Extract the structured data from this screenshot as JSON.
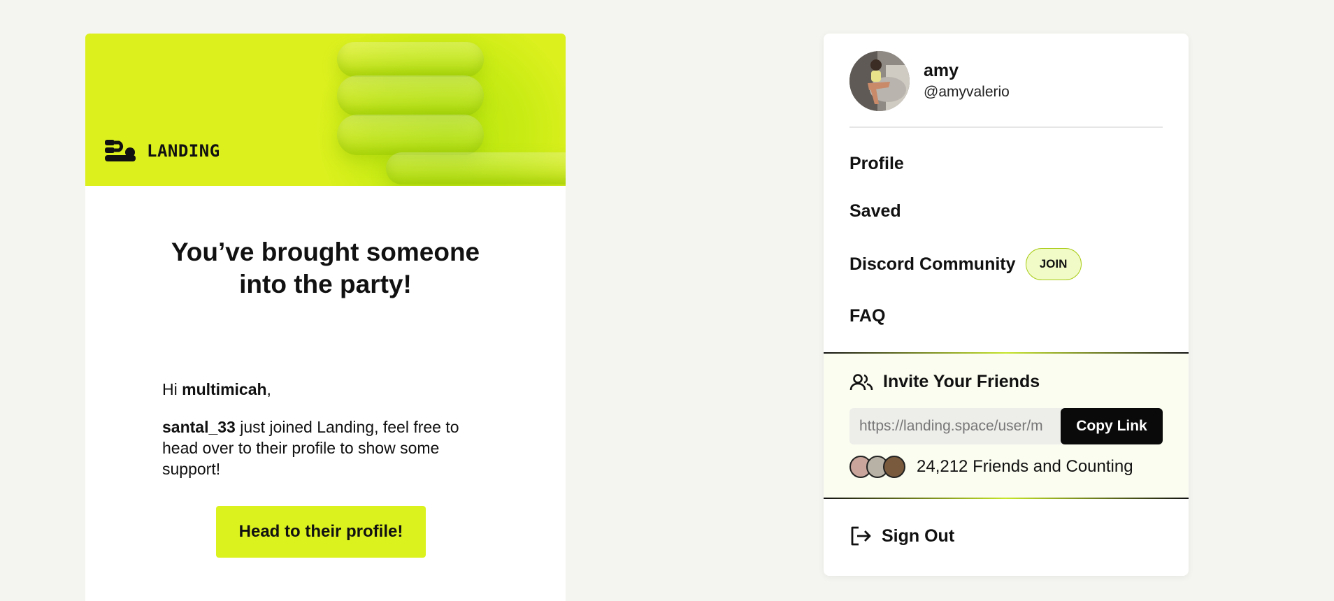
{
  "email": {
    "brand": "LANDING",
    "title_line1": "You’ve brought someone",
    "title_line2": "into the party!",
    "greeting_prefix": "Hi ",
    "greeting_name": "multimicah",
    "greeting_suffix": ",",
    "body_user": "santal_33",
    "body_text": " just joined Landing, feel free to head over to their profile to show some support!",
    "cta_label": "Head to their profile!",
    "accent_color": "#dcf21f"
  },
  "menu": {
    "user": {
      "name": "amy",
      "handle": "@amyvalerio"
    },
    "items": {
      "profile": "Profile",
      "saved": "Saved",
      "discord": "Discord Community",
      "join_badge": "JOIN",
      "faq": "FAQ"
    },
    "invite": {
      "title": "Invite Your Friends",
      "icon": "users-icon",
      "link_value": "https://landing.space/user/m",
      "copy_label": "Copy Link",
      "friends_count_text": "24,212 Friends and Counting"
    },
    "signout": {
      "label": "Sign Out",
      "icon": "sign-out-icon"
    }
  }
}
